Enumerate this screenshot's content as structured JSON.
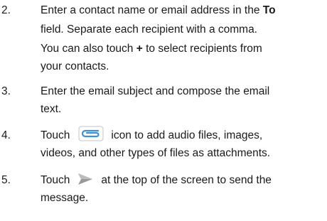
{
  "steps": [
    {
      "number": "2.",
      "line1_pre": "Enter a contact name or email address in the ",
      "line1_bold": "To",
      "line2": "field. Separate each recipient with a comma.",
      "line3_pre": "You can also touch ",
      "line3_icon": "+",
      "line3_post": " to select recipients from",
      "line4": "your contacts."
    },
    {
      "number": "3.",
      "line1": "Enter the email subject and compose the email",
      "line2": "text."
    },
    {
      "number": "4.",
      "line1_pre": "Touch",
      "icon": "paperclip-icon",
      "line1_post": "icon to add audio files, images,",
      "line2": "videos, and other types of files as attachments."
    },
    {
      "number": "5.",
      "line1_pre": "Touch",
      "icon": "send-icon",
      "line1_post": "at the top of the screen to send the",
      "line2": "message."
    }
  ],
  "colors": {
    "text": "#1a1a1a",
    "icon_blue": "#3d8fd6",
    "icon_gray": "#9a9a9a"
  }
}
